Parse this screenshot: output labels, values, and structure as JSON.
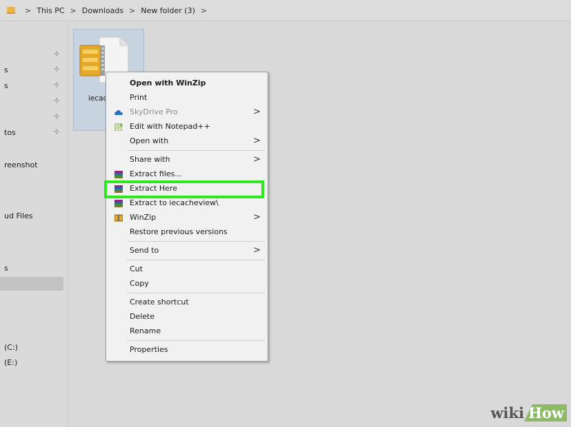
{
  "address_bar": {
    "breadcrumbs": [
      "This PC",
      "Downloads",
      "New folder (3)"
    ],
    "separator": ">"
  },
  "nav": {
    "items": [
      {
        "label": "s"
      },
      {
        "label": "s"
      },
      {
        "label": "tos"
      },
      {
        "label": "reenshot"
      },
      {
        "label": "ud Files"
      },
      {
        "label": "s"
      },
      {
        "label": "(C:)"
      },
      {
        "label": "(E:)"
      }
    ],
    "pin_glyph": "⊹"
  },
  "file": {
    "name": "iecacl",
    "icon": "winzip-archive-icon"
  },
  "context_menu": {
    "items": [
      {
        "label": "Open with WinZip",
        "bold": true
      },
      {
        "label": "Print"
      },
      {
        "label": "SkyDrive Pro",
        "disabled": true,
        "icon": "skydrive-cloud-icon",
        "submenu": true
      },
      {
        "label": "Edit with Notepad++",
        "icon": "notepad-plus-icon"
      },
      {
        "label": "Open with",
        "submenu": true
      },
      {
        "label": "Share with",
        "submenu": true
      },
      {
        "label": "Extract files...",
        "icon": "winrar-icon"
      },
      {
        "label": "Extract Here",
        "icon": "winrar-icon",
        "highlighted": true
      },
      {
        "label": "Extract to iecacheview\\",
        "icon": "winrar-icon"
      },
      {
        "label": "WinZip",
        "icon": "winzip-icon",
        "submenu": true
      },
      {
        "label": "Restore previous versions"
      },
      {
        "label": "Send to",
        "submenu": true
      },
      {
        "label": "Cut"
      },
      {
        "label": "Copy"
      },
      {
        "label": "Create shortcut"
      },
      {
        "label": "Delete"
      },
      {
        "label": "Rename"
      },
      {
        "label": "Properties"
      }
    ],
    "submenu_arrow": ">"
  },
  "colors": {
    "highlight_border": "#2ee81d",
    "selection": "#c7d3df",
    "watermark_green": "#8dbb63"
  },
  "watermark": {
    "wiki": "wiki",
    "how": "How"
  }
}
